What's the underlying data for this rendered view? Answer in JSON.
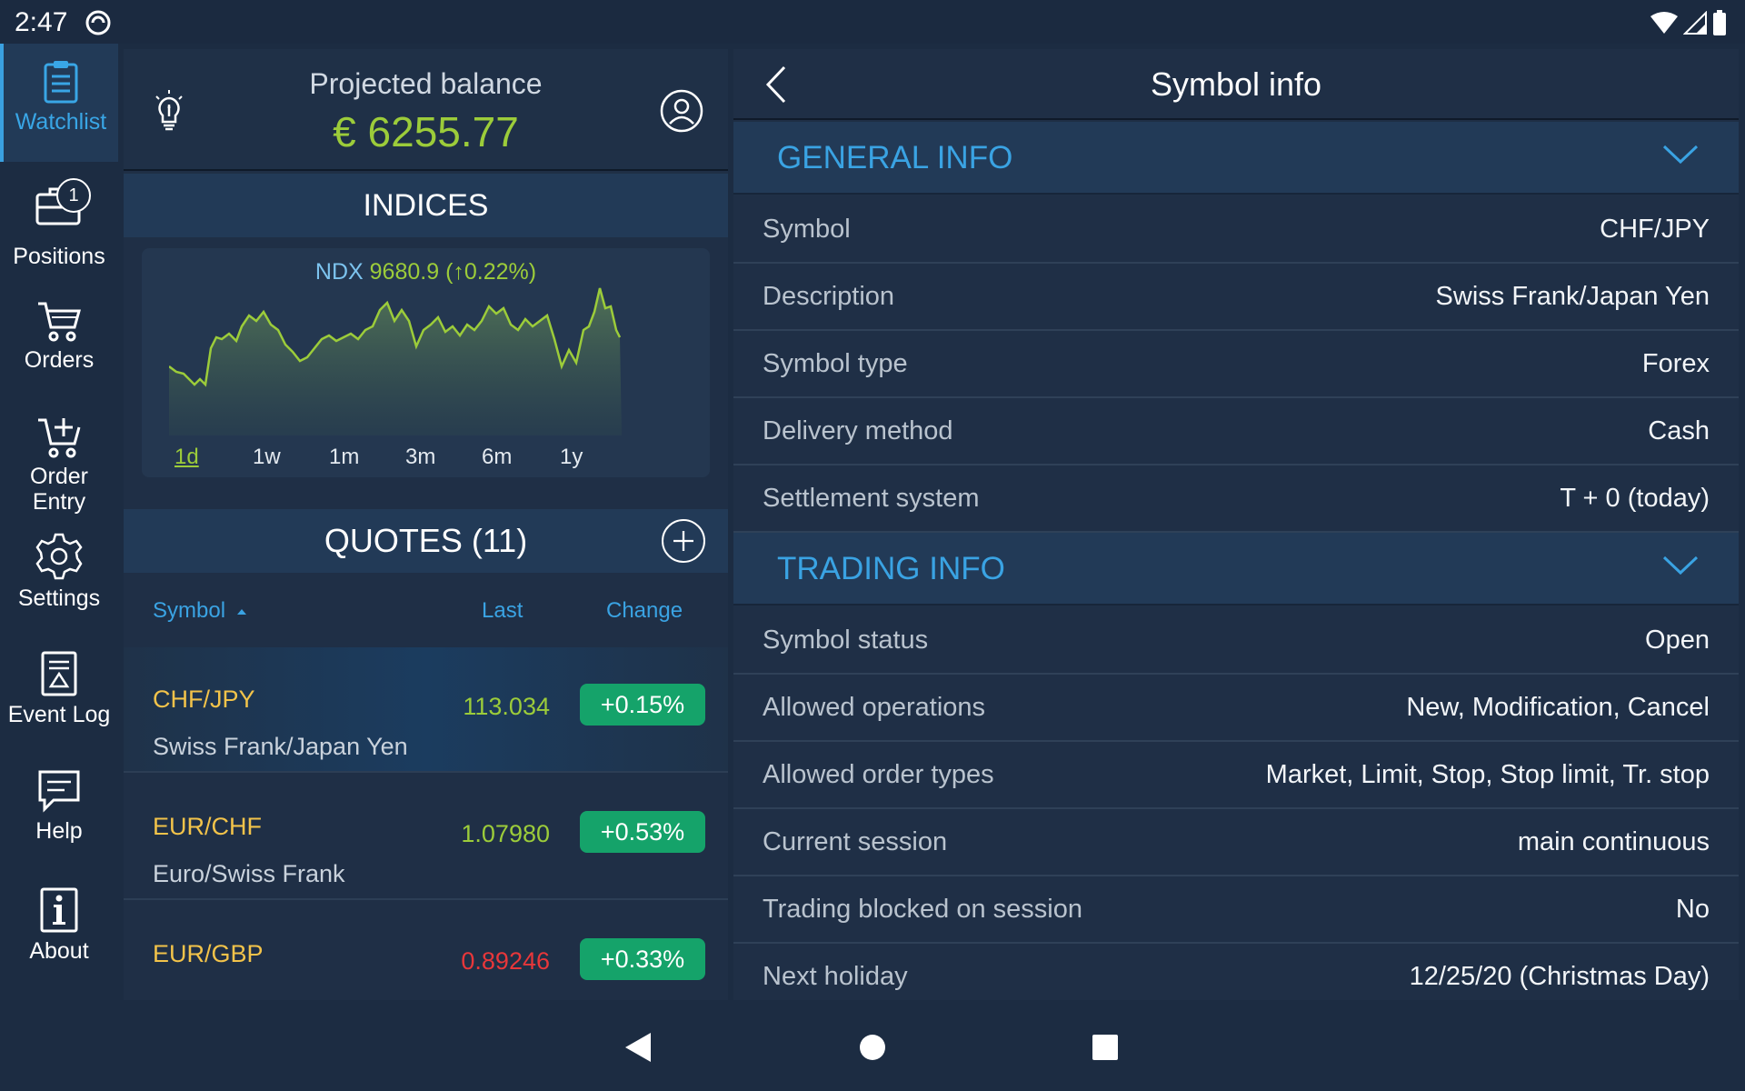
{
  "status": {
    "time": "2:47"
  },
  "sidebar": {
    "items": [
      {
        "label": "Watchlist",
        "icon": "clipboard-icon",
        "active": true
      },
      {
        "label": "Positions",
        "icon": "briefcase-icon",
        "badge": "1"
      },
      {
        "label": "Orders",
        "icon": "cart-icon"
      },
      {
        "label": "Order Entry",
        "label_line1": "Order",
        "label_line2": "Entry",
        "icon": "cart-add-icon"
      },
      {
        "label": "Settings",
        "icon": "gear-icon"
      },
      {
        "label": "Event Log",
        "icon": "log-icon"
      },
      {
        "label": "Help",
        "icon": "help-icon"
      },
      {
        "label": "About",
        "icon": "info-icon"
      }
    ]
  },
  "watchlist": {
    "balance_label": "Projected balance",
    "balance_value": "€ 6255.77",
    "indices_title": "INDICES",
    "index": {
      "symbol": "NDX",
      "value": "9680.9",
      "change": "(↑0.22%)"
    },
    "ranges": [
      "1d",
      "1w",
      "1m",
      "3m",
      "6m",
      "1y"
    ],
    "selected_range": "1d",
    "quotes_title": "QUOTES (11)",
    "columns": {
      "symbol": "Symbol",
      "last": "Last",
      "change": "Change"
    },
    "quotes": [
      {
        "symbol": "CHF/JPY",
        "description": "Swiss Frank/Japan Yen",
        "last": "113.034",
        "last_color": "#9ccc3a",
        "change": "+0.15%"
      },
      {
        "symbol": "EUR/CHF",
        "description": "Euro/Swiss Frank",
        "last": "1.07980",
        "last_color": "#9ccc3a",
        "change": "+0.53%"
      },
      {
        "symbol": "EUR/GBP",
        "description": "",
        "last": "0.89246",
        "last_color": "#e8373a",
        "change": "+0.33%"
      }
    ]
  },
  "symbol_info": {
    "title": "Symbol info",
    "general_title": "GENERAL INFO",
    "general": [
      {
        "label": "Symbol",
        "value": "CHF/JPY"
      },
      {
        "label": "Description",
        "value": "Swiss Frank/Japan Yen"
      },
      {
        "label": "Symbol type",
        "value": "Forex"
      },
      {
        "label": "Delivery method",
        "value": "Cash"
      },
      {
        "label": "Settlement system",
        "value": "T + 0 (today)"
      }
    ],
    "trading_title": "TRADING INFO",
    "trading": [
      {
        "label": "Symbol status",
        "value": "Open"
      },
      {
        "label": "Allowed operations",
        "value": "New, Modification, Cancel"
      },
      {
        "label": "Allowed order types",
        "value": "Market, Limit, Stop, Stop limit, Tr. stop"
      },
      {
        "label": "Current session",
        "value": "main continuous"
      },
      {
        "label": "Trading blocked on session",
        "value": "No"
      },
      {
        "label": "Next holiday",
        "value": "12/25/20 (Christmas Day)"
      }
    ]
  },
  "colors": {
    "accent": "#3aa3e3",
    "positive": "#15a36a",
    "balance": "#9ccc3a",
    "symbol": "#f2c34a",
    "negative": "#e8373a"
  }
}
